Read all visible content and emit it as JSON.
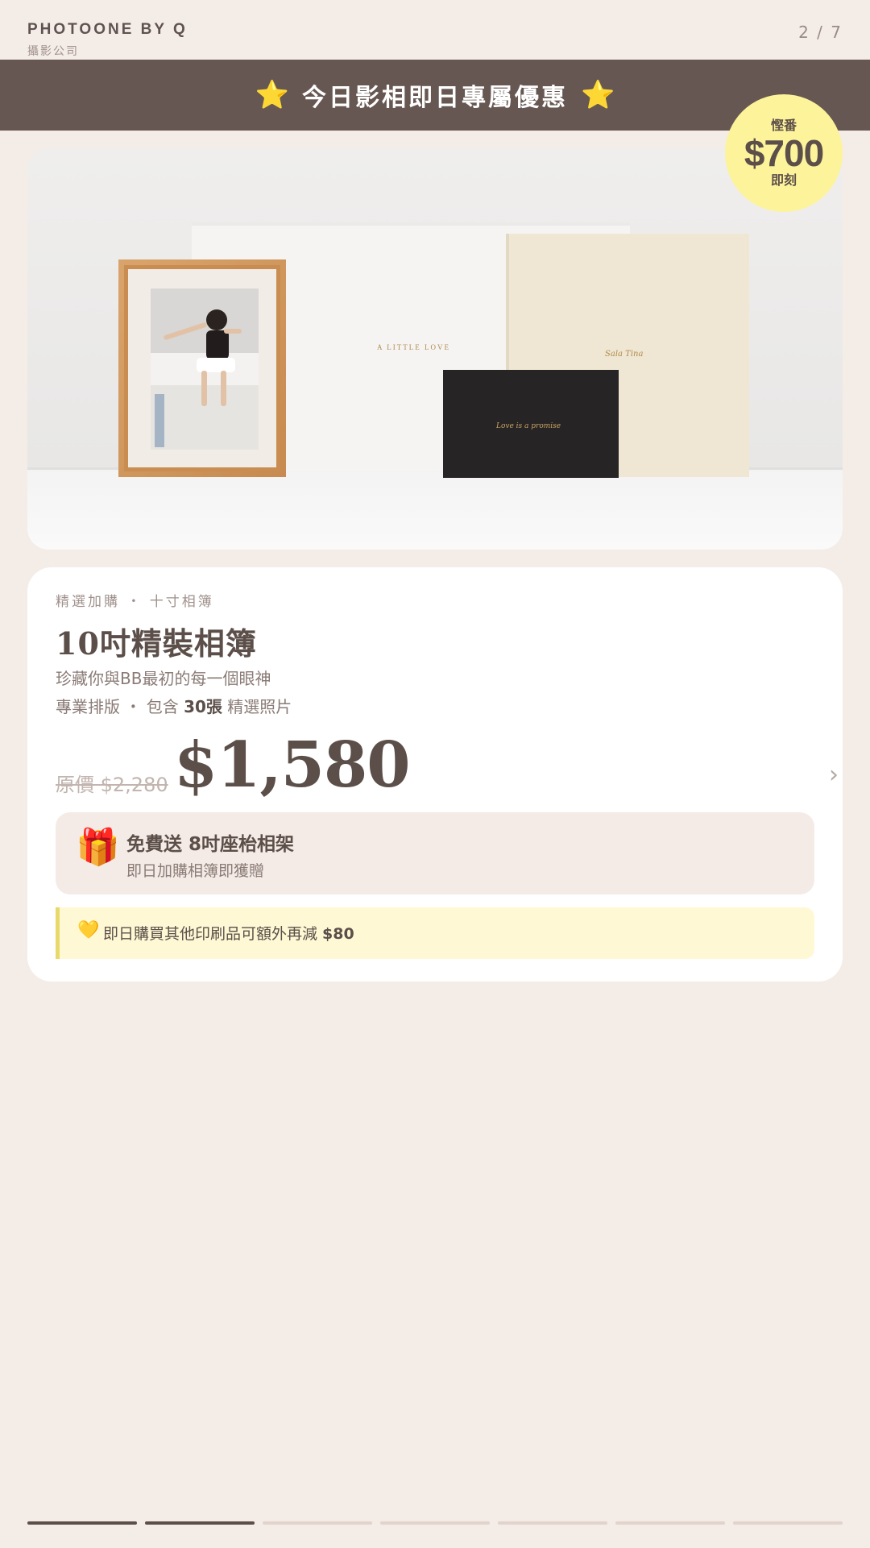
{
  "header": {
    "brand": "PHOTOONE BY Q",
    "brand_sub": "攝影公司",
    "page_counter": "2 / 7"
  },
  "banner": {
    "title": "今日影相即日專屬優惠",
    "star": "⭐"
  },
  "save_badge": {
    "top": "慳番",
    "amount": "$700",
    "bottom": "即刻"
  },
  "hero_image": {
    "album_text": "A LITTLE LOVE",
    "cream_album_text": "Sala Tina",
    "black_album_text": "Love is a promise"
  },
  "product": {
    "eyebrow": "精選加購 ・ 十寸相簿",
    "title": "10吋精裝相簿",
    "desc1": "珍藏你與BB最初的每一個眼神",
    "desc2_pre": "專業排版 ・ 包含 ",
    "desc2_bold": "30張",
    "desc2_post": " 精選照片",
    "orig_label": "原價 ",
    "orig_price": "$2,280",
    "sale_price": "$1,580"
  },
  "gift": {
    "icon": "🎁",
    "title": "免費送 8吋座枱相架",
    "subtitle": "即日加購相簿即獲贈"
  },
  "note": {
    "icon": "💛",
    "text": "即日購買其他印刷品可額外再減 ",
    "amount": "$80"
  },
  "progress": {
    "current": 2,
    "total": 7
  },
  "colors": {
    "background": "#f4ece7",
    "banner": "#675752",
    "badge": "#fdf39a",
    "text_dark": "#5c4f4a",
    "note_bg": "#fef9d4"
  }
}
